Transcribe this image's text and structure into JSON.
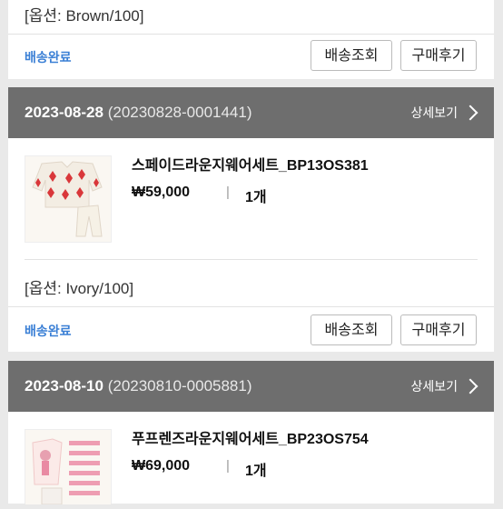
{
  "orders": [
    {
      "option": "[옵션: Brown/100]",
      "status": "배송완료",
      "ship_btn": "배송조회",
      "review_btn": "구매후기"
    },
    {
      "date": "2023-08-28",
      "order_no": "(20230828-0001441)",
      "detail": "상세보기",
      "product": "스페이드라운지웨어세트_BP13OS381",
      "price": "₩59,000",
      "separator": "|",
      "qty": "1개",
      "option": "[옵션: Ivory/100]",
      "status": "배송완료",
      "ship_btn": "배송조회",
      "review_btn": "구매후기"
    },
    {
      "date": "2023-08-10",
      "order_no": "(20230810-0005881)",
      "detail": "상세보기",
      "product": "푸프렌즈라운지웨어세트_BP23OS754",
      "price": "₩69,000",
      "separator": "|",
      "qty": "1개"
    }
  ]
}
